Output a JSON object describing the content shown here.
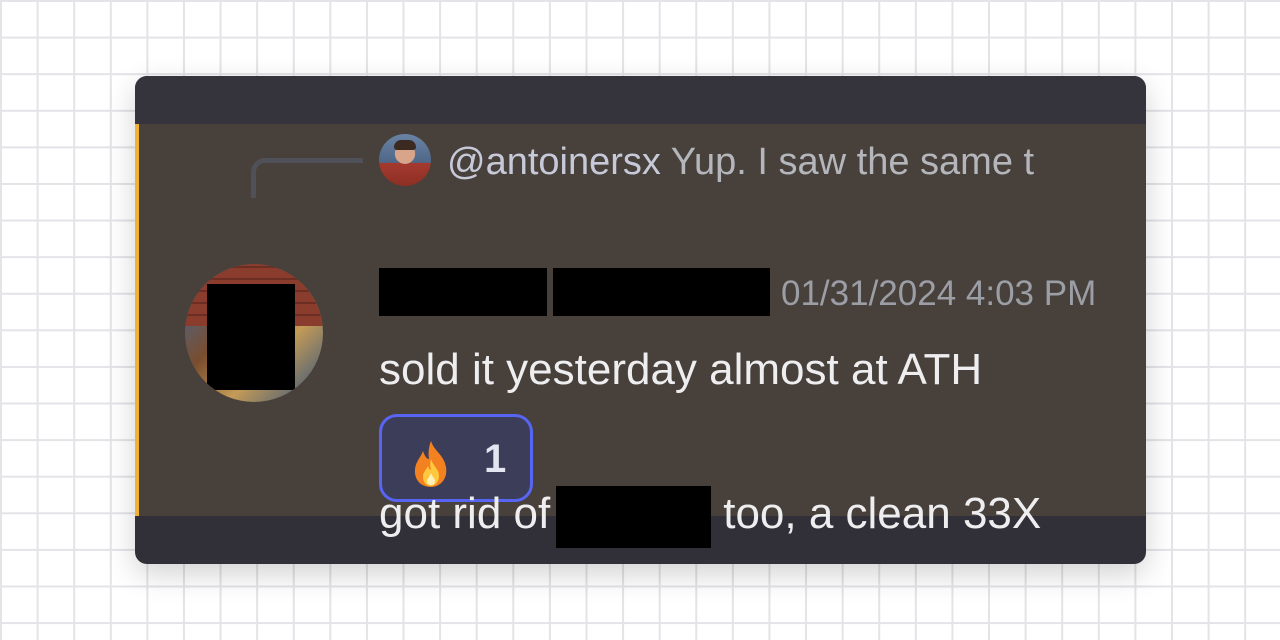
{
  "colors": {
    "card_bg": "#313038",
    "highlight_bg": "#47403b",
    "highlight_bar": "#f0b232",
    "reaction_border": "#5865f2",
    "reaction_bg": "#3c3d58",
    "timestamp": "#9c9ea6",
    "text": "#eeeef0"
  },
  "reply": {
    "mention": "@antoinersx",
    "text": "Yup. I saw the same t"
  },
  "message": {
    "timestamp": "01/31/2024 4:03 PM",
    "content": "sold it yesterday almost at ATH",
    "reaction": {
      "emoji": "flame-emoji",
      "count": "1"
    }
  },
  "next_message": {
    "before": "got rid of",
    "after": "too, a clean 33X"
  }
}
